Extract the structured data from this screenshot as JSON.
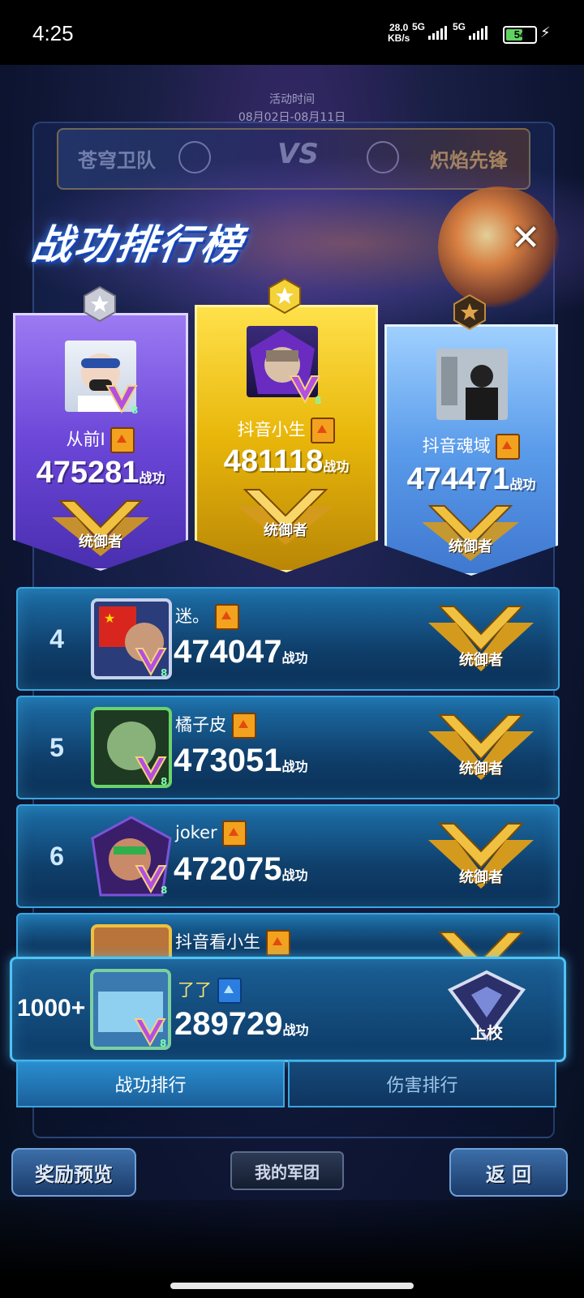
{
  "status_bar": {
    "time": "4:25",
    "speed_value": "28.0",
    "speed_unit": "KB/s",
    "net1": "5G",
    "net2": "5G",
    "battery": "54"
  },
  "event": {
    "label": "活动时间",
    "dates": "08月02日-08月11日",
    "team_left": "苍穹卫队",
    "vs": "VS",
    "team_right": "炽焰先锋"
  },
  "panel": {
    "title": "战功排行榜",
    "close": "✕"
  },
  "score_unit": "战功",
  "podium": [
    {
      "rank": 2,
      "name": "从前I",
      "score": "475281",
      "title": "统御者",
      "level": "8",
      "faction": "orange",
      "color": "purple"
    },
    {
      "rank": 1,
      "name": "抖音小生",
      "score": "481118",
      "title": "统御者",
      "level": "8",
      "faction": "orange",
      "color": "gold"
    },
    {
      "rank": 3,
      "name": "抖音魂域",
      "score": "474471",
      "title": "统御者",
      "level": "8",
      "faction": "orange",
      "color": "blue"
    }
  ],
  "rows": [
    {
      "rank": "4",
      "name": "迷。",
      "score": "474047",
      "title": "统御者",
      "level": "8"
    },
    {
      "rank": "5",
      "name": "橘子皮",
      "score": "473051",
      "title": "统御者",
      "level": "8"
    },
    {
      "rank": "6",
      "name": "joker",
      "score": "472075",
      "title": "统御者",
      "level": "8"
    },
    {
      "rank": "",
      "name": "抖音看小生",
      "score": "",
      "title": "",
      "level": ""
    }
  ],
  "self": {
    "rank": "1000+",
    "name": "了了",
    "score": "289729",
    "title": "上校",
    "level": "8"
  },
  "tabs": [
    "战功排行",
    "伤害排行"
  ],
  "bottom": {
    "reward_preview": "奖励预览",
    "my_legion": "我的军团",
    "back": "返 回"
  },
  "colors": {
    "gold": "#f3c21c",
    "purple": "#7b58e8",
    "blue": "#4a8fe6",
    "row_border": "#3aa6e0"
  }
}
